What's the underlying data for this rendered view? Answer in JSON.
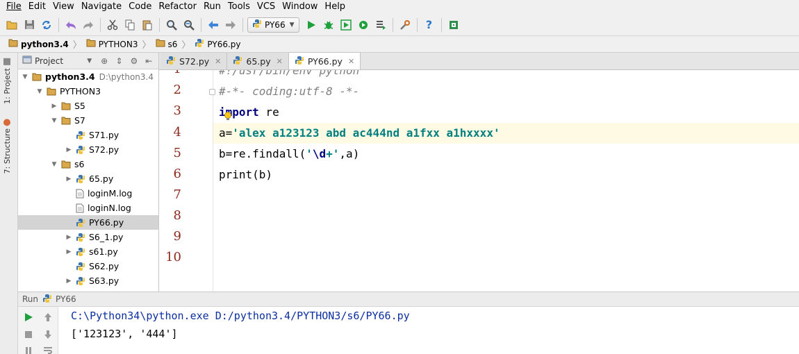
{
  "menu": [
    "File",
    "Edit",
    "View",
    "Navigate",
    "Code",
    "Refactor",
    "Run",
    "Tools",
    "VCS",
    "Window",
    "Help"
  ],
  "toolbar": {
    "run_config": "PY66",
    "icons": [
      "open-folder-icon",
      "save-icon",
      "sync-icon",
      "undo-icon",
      "redo-icon",
      "cut-icon",
      "copy-icon",
      "paste-icon",
      "find-icon",
      "replace-icon",
      "back-icon",
      "forward-icon",
      "run-icon",
      "debug-icon",
      "run-coverage-icon",
      "profile-icon",
      "concurrency-icon",
      "settings-icon",
      "help-icon",
      "sdk-icon"
    ]
  },
  "breadcrumb": [
    "python3.4",
    "PYTHON3",
    "s6",
    "PY66.py"
  ],
  "left_strip": {
    "project_tab": "1: Project",
    "structure_tab": "7: Structure"
  },
  "project_panel": {
    "title": "Project",
    "tree": [
      {
        "label": "python3.4",
        "path": "D:\\python3.4",
        "type": "folder",
        "depth": 0,
        "expanded": true,
        "bold": true
      },
      {
        "label": "PYTHON3",
        "type": "folder",
        "depth": 1,
        "expanded": true
      },
      {
        "label": "S5",
        "type": "folder",
        "depth": 2,
        "expanded": false
      },
      {
        "label": "S7",
        "type": "folder",
        "depth": 2,
        "expanded": true
      },
      {
        "label": "S71.py",
        "type": "py",
        "depth": 3
      },
      {
        "label": "S72.py",
        "type": "py-collapsible",
        "depth": 3
      },
      {
        "label": "s6",
        "type": "folder",
        "depth": 2,
        "expanded": true
      },
      {
        "label": "65.py",
        "type": "py-collapsible",
        "depth": 3
      },
      {
        "label": "loginM.log",
        "type": "file",
        "depth": 3
      },
      {
        "label": "loginN.log",
        "type": "file",
        "depth": 3
      },
      {
        "label": "PY66.py",
        "type": "py",
        "depth": 3,
        "selected": true
      },
      {
        "label": "S6_1.py",
        "type": "py-collapsible",
        "depth": 3
      },
      {
        "label": "s61.py",
        "type": "py-collapsible",
        "depth": 3
      },
      {
        "label": "S62.py",
        "type": "py",
        "depth": 3
      },
      {
        "label": "S63.py",
        "type": "py-collapsible",
        "depth": 3
      }
    ]
  },
  "tabs": [
    {
      "label": "S72.py",
      "active": false
    },
    {
      "label": "65.py",
      "active": false
    },
    {
      "label": "PY66.py",
      "active": true
    }
  ],
  "editor": {
    "line_numbers": [
      "1",
      "2",
      "3",
      "4",
      "5",
      "6",
      "7",
      "8",
      "9",
      "10"
    ],
    "current_line": 4,
    "lines": {
      "l1": "#!/usr/bin/env python",
      "l2": "#-*- coding:utf-8 -*-",
      "l3_kw": "import",
      "l3_rest": " re",
      "l4_a": "a=",
      "l4_str": "'alex a123123 abd ac444nd a1fxx a1hxxxx'",
      "l5_a": "b=re.findall(",
      "l5_q1": "'",
      "l5_esc": "\\d",
      "l5_plus": "+",
      "l5_q2": "'",
      "l5_b": ",a)",
      "l6": "print(b)"
    }
  },
  "run_panel": {
    "label": "Run",
    "config": "PY66",
    "console": [
      "C:\\Python34\\python.exe D:/python3.4/PYTHON3/s6/PY66.py",
      "['123123', '444']"
    ]
  },
  "colors": {
    "line_number": "#8c2a1e",
    "keyword": "#000080",
    "string": "#008080",
    "comment": "#808080",
    "current_line_bg": "#fffae3",
    "selection_bg": "#d4d4d4"
  }
}
